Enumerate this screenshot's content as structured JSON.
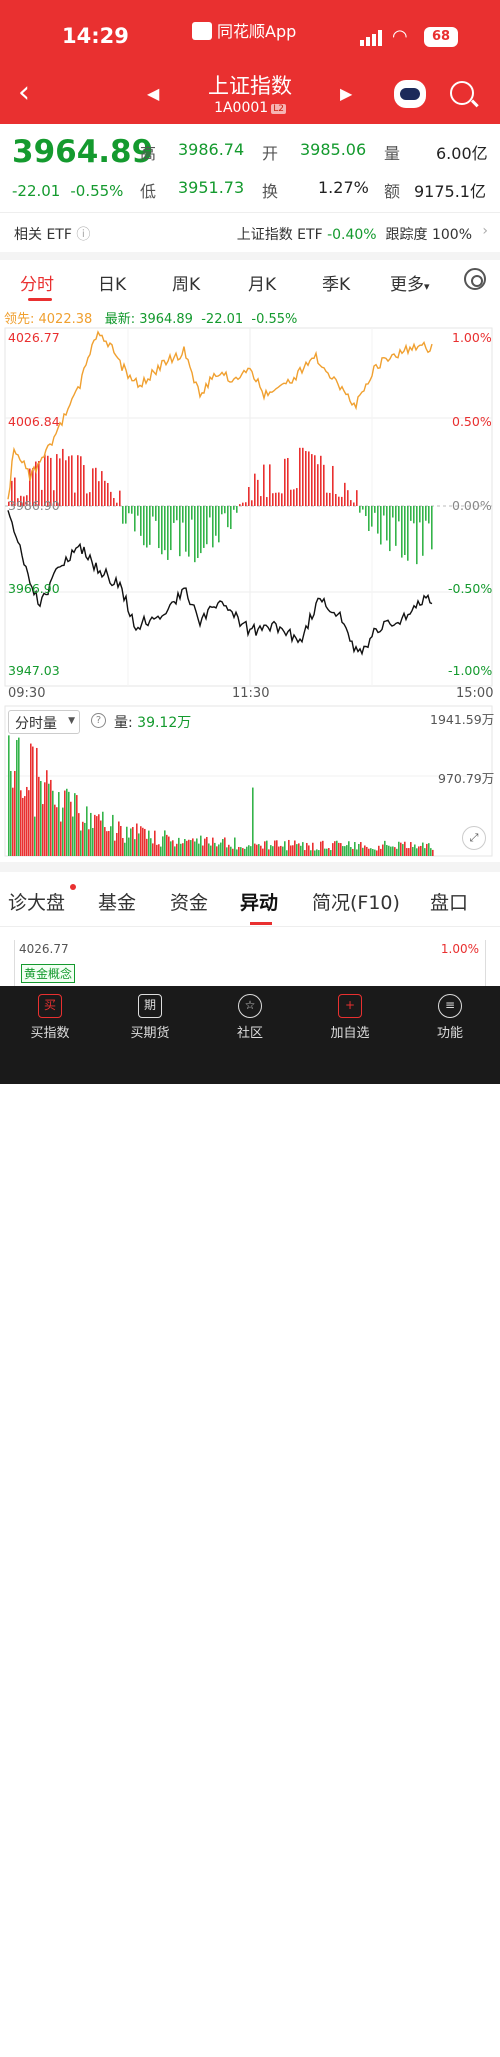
{
  "status": {
    "time": "14:29",
    "app_name": "同花顺App",
    "battery": "68"
  },
  "nav": {
    "title": "上证指数",
    "code": "1A0001",
    "level": "L2"
  },
  "quote": {
    "price": "3964.89",
    "change": "-22.01",
    "change_pct": "-0.55%",
    "high_label": "高",
    "high": "3986.74",
    "open_label": "开",
    "open": "3985.06",
    "vol_label": "量",
    "vol": "6.00亿",
    "low_label": "低",
    "low": "3951.73",
    "turn_label": "换",
    "turn": "1.27%",
    "amt_label": "额",
    "amt": "9175.1亿"
  },
  "etf": {
    "label": "相关 ETF",
    "name": "上证指数 ETF",
    "pct": "-0.40%",
    "track_label": "跟踪度",
    "track": "100%"
  },
  "tabs": [
    "分时",
    "日K",
    "周K",
    "月K",
    "季K",
    "更多"
  ],
  "legend": {
    "lead": "领先: 4022.38",
    "latest": "最新: 3964.89",
    "chg": "-22.01",
    "pct": "-0.55%"
  },
  "chart_labels": {
    "p_top": "4026.77",
    "p_mid": "4006.84",
    "p_low": "3966.90",
    "p_bot": "3947.03",
    "pct_top": "1.00%",
    "pct_mid": "0.50%",
    "pct_zero": "0.00%",
    "pct_neg": "-0.50%",
    "pct_bot": "-1.00%",
    "prev_close": "3986.90"
  },
  "time_axis": [
    "09:30",
    "11:30",
    "15:00"
  ],
  "volume": {
    "selector": "分时量",
    "vol_label": "量:",
    "vol_value": "39.12万",
    "max": "1941.59万",
    "mid": "970.79万"
  },
  "bottom_tabs": [
    "诊大盘",
    "基金",
    "资金",
    "异动",
    "简况(F10)",
    "盘口"
  ],
  "mini": {
    "price": "4026.77",
    "pct": "1.00%",
    "tag": "黄金概念"
  },
  "bottom_nav": [
    {
      "label": "买指数",
      "icon": "买"
    },
    {
      "label": "买期货",
      "icon": "期"
    },
    {
      "label": "社区",
      "icon": "☆"
    },
    {
      "label": "加自选",
      "icon": "+"
    },
    {
      "label": "功能",
      "icon": "≡"
    }
  ],
  "colors": {
    "red": "#e93030",
    "green": "#149a2e",
    "orange": "#f0a030"
  }
}
